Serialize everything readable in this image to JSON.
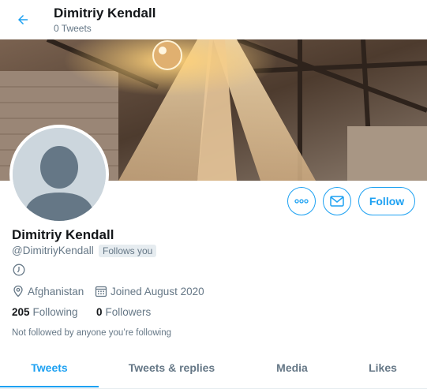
{
  "header": {
    "name": "Dimitriy Kendall",
    "tweet_count": "0 Tweets"
  },
  "profile": {
    "name": "Dimitriy Kendall",
    "handle": "@DimitriyKendall",
    "follows_you": "Follows you",
    "location": "Afghanistan",
    "joined": "Joined August 2020",
    "following_count": "205",
    "following_label": "Following",
    "followers_count": "0",
    "followers_label": "Followers",
    "not_followed": "Not followed by anyone you’re following"
  },
  "actions": {
    "follow_label": "Follow",
    "more_icon": "more-icon",
    "message_icon": "mail-icon"
  },
  "tabs": [
    {
      "label": "Tweets",
      "active": true
    },
    {
      "label": "Tweets & replies",
      "active": false
    },
    {
      "label": "Media",
      "active": false
    },
    {
      "label": "Likes",
      "active": false
    }
  ],
  "colors": {
    "accent": "#1da1f2",
    "text": "#14171a",
    "muted": "#657786"
  }
}
